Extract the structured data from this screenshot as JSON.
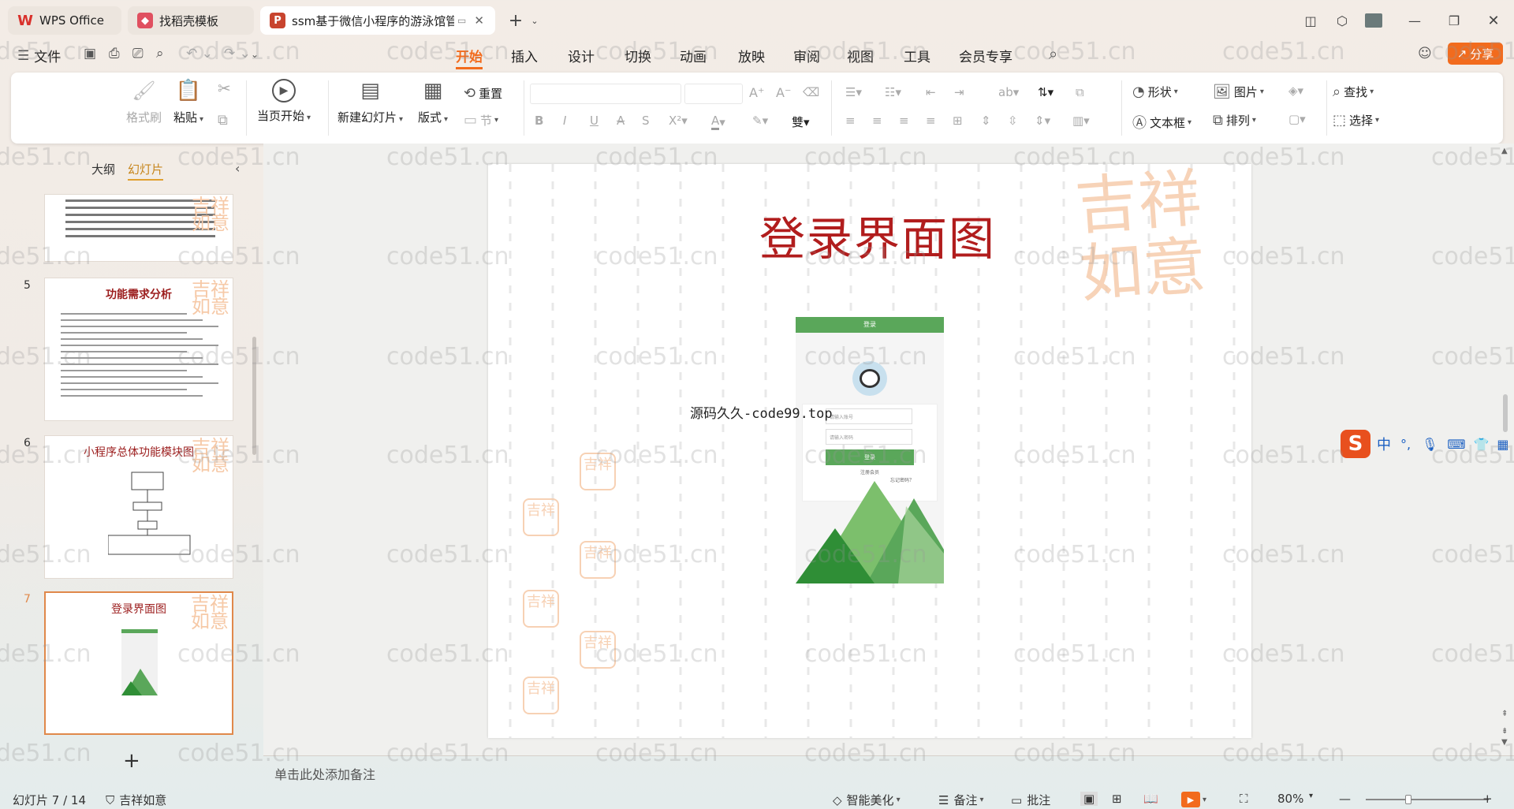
{
  "tabs": [
    {
      "label": "WPS Office",
      "logo": "W",
      "color": "#d9312c"
    },
    {
      "label": "找稻壳模板",
      "logo": "稻",
      "color": "#e05060"
    },
    {
      "label": "ssm基于微信小程序的游泳馆管",
      "logo": "P",
      "color": "#c8442e"
    }
  ],
  "quick": {
    "file_label": "文件"
  },
  "menu": [
    "开始",
    "插入",
    "设计",
    "切换",
    "动画",
    "放映",
    "审阅",
    "视图",
    "工具",
    "会员专享"
  ],
  "share_label": "分享",
  "ribbon": {
    "format_painter": "格式刷",
    "paste": "粘贴",
    "play_current": "当页开始",
    "new_slide": "新建幻灯片",
    "layout": "版式",
    "reset": "重置",
    "section": "节",
    "shape": "形状",
    "picture": "图片",
    "textbox": "文本框",
    "arrange": "排列",
    "find": "查找",
    "select": "选择"
  },
  "panel": {
    "outline_tab": "大纲",
    "slides_tab": "幻灯片"
  },
  "thumbs": [
    {
      "num": "",
      "title": ""
    },
    {
      "num": "5",
      "title": "功能需求分析"
    },
    {
      "num": "6",
      "title": "小程序总体功能模块图"
    },
    {
      "num": "7",
      "title": "登录界面图"
    }
  ],
  "slide": {
    "title": "登录界面图",
    "overlay_text": "源码久久-code99.top",
    "phone_header": "登录",
    "account_ph": "请输入账号",
    "password_ph": "请输入密码",
    "login_btn": "登录",
    "register": "注册会员",
    "forgot": "忘记密码？"
  },
  "notes_placeholder": "单击此处添加备注",
  "status": {
    "slide_count": "幻灯片 7 / 14",
    "theme": "吉祥如意",
    "beautify": "智能美化",
    "notes": "备注",
    "comments": "批注",
    "zoom": "80%"
  },
  "ime": {
    "lang": "中",
    "punct": "°,"
  },
  "watermark": "code51.cn",
  "colors": {
    "accent": "#f26b1d",
    "title_red": "#b11d1d",
    "green": "#5aa75a"
  }
}
